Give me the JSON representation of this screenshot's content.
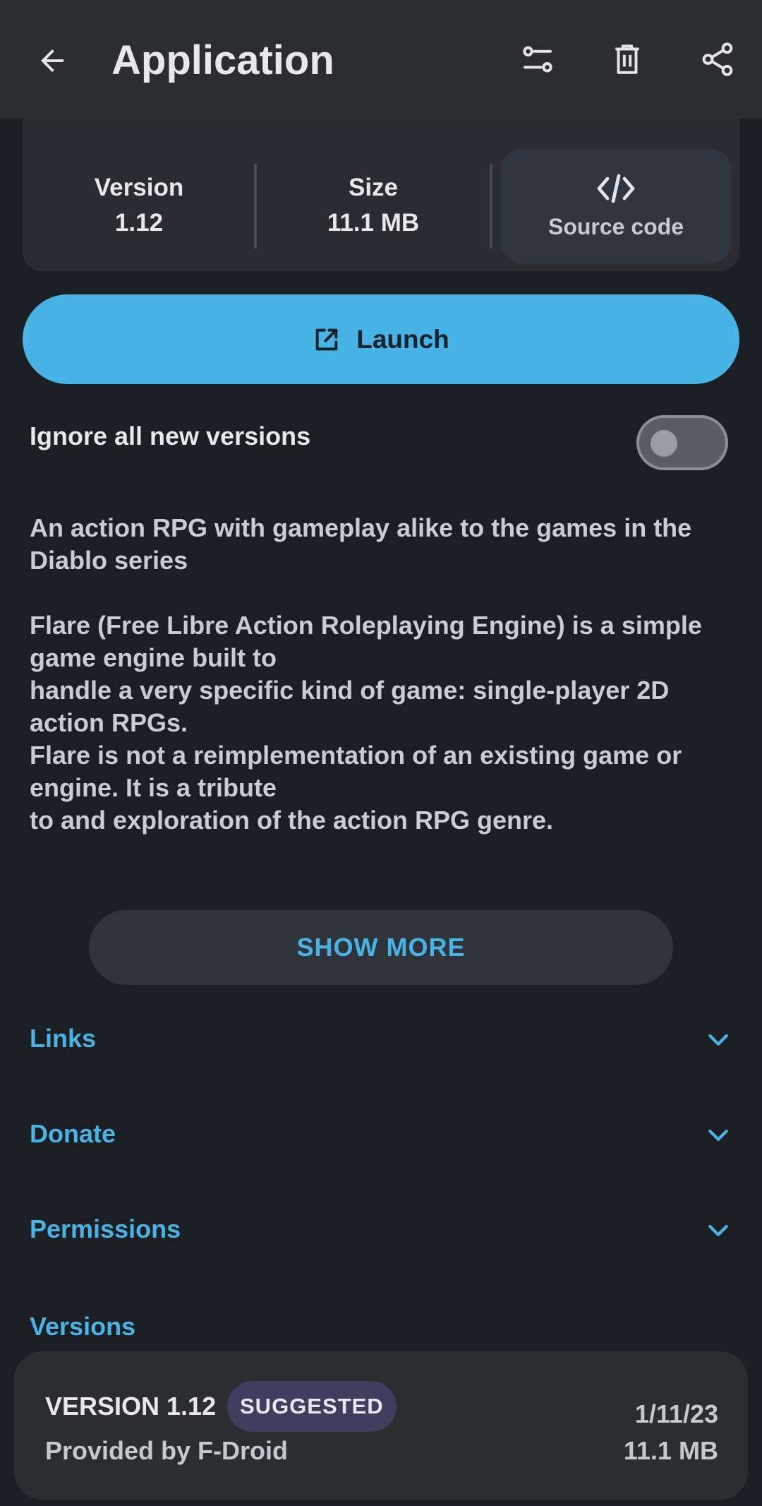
{
  "appbar": {
    "title": "Application",
    "icons": [
      "back-arrow-icon",
      "settings-sliders-icon",
      "trash-icon",
      "share-icon"
    ]
  },
  "info": {
    "version_label": "Version",
    "version_value": "1.12",
    "size_label": "Size",
    "size_value": "11.1 MB",
    "source_label": "Source code"
  },
  "launch": {
    "label": "Launch"
  },
  "ignore": {
    "label": "Ignore all new versions",
    "enabled": false
  },
  "description": {
    "summary": "An action RPG with gameplay alike to the games in the Diablo series",
    "lines": [
      "Flare (Free Libre Action Roleplaying Engine) is a simple game engine built to",
      "handle a very specific kind of game: single-player 2D action RPGs.",
      "Flare is not a reimplementation of an existing game or engine. It is a tribute",
      "to and exploration of the action RPG genre."
    ]
  },
  "show_more": {
    "label": "SHOW MORE"
  },
  "sections": {
    "links": "Links",
    "donate": "Donate",
    "permissions": "Permissions",
    "versions": "Versions"
  },
  "version_item": {
    "version": "VERSION 1.12",
    "badge": "SUGGESTED",
    "provider": "Provided by F-Droid",
    "date": "1/11/23",
    "size": "11.1 MB"
  },
  "colors": {
    "accent": "#48b4e6",
    "background": "#1b1e22",
    "surface": "#2b2d31",
    "badge": "#413d5e"
  }
}
